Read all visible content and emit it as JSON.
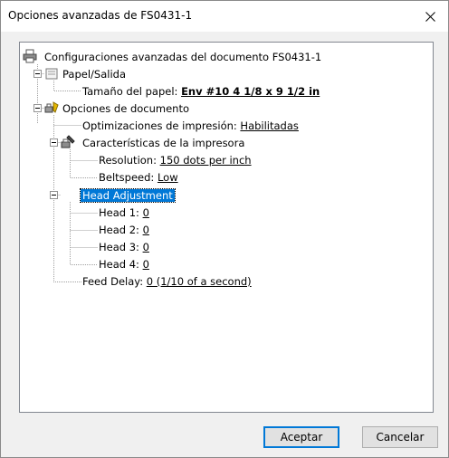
{
  "window": {
    "title": "Opciones avanzadas de FS0431-1"
  },
  "tree": {
    "root": "Configuraciones avanzadas del documento FS0431-1",
    "paper_output": "Papel/Salida",
    "paper_size_label": "Tamaño del papel:",
    "paper_size_value": "Env #10 4 1/8 x 9 1/2 in",
    "doc_options": "Opciones de documento",
    "print_opt_label": "Optimizaciones de impresión:",
    "print_opt_value": "Habilitadas",
    "printer_features": "Características de la impresora",
    "resolution_label": "Resolution:",
    "resolution_value": "150 dots per inch",
    "beltspeed_label": "Beltspeed:",
    "beltspeed_value": "Low",
    "head_adjustment": "Head Adjustment",
    "heads": [
      {
        "label": "Head 1:",
        "value": "0"
      },
      {
        "label": "Head 2:",
        "value": "0"
      },
      {
        "label": "Head 3:",
        "value": "0"
      },
      {
        "label": "Head 4:",
        "value": "0"
      }
    ],
    "feed_delay_label": "Feed Delay:",
    "feed_delay_value": "0  (1/10 of a second)"
  },
  "buttons": {
    "accept": "Aceptar",
    "cancel": "Cancelar"
  }
}
